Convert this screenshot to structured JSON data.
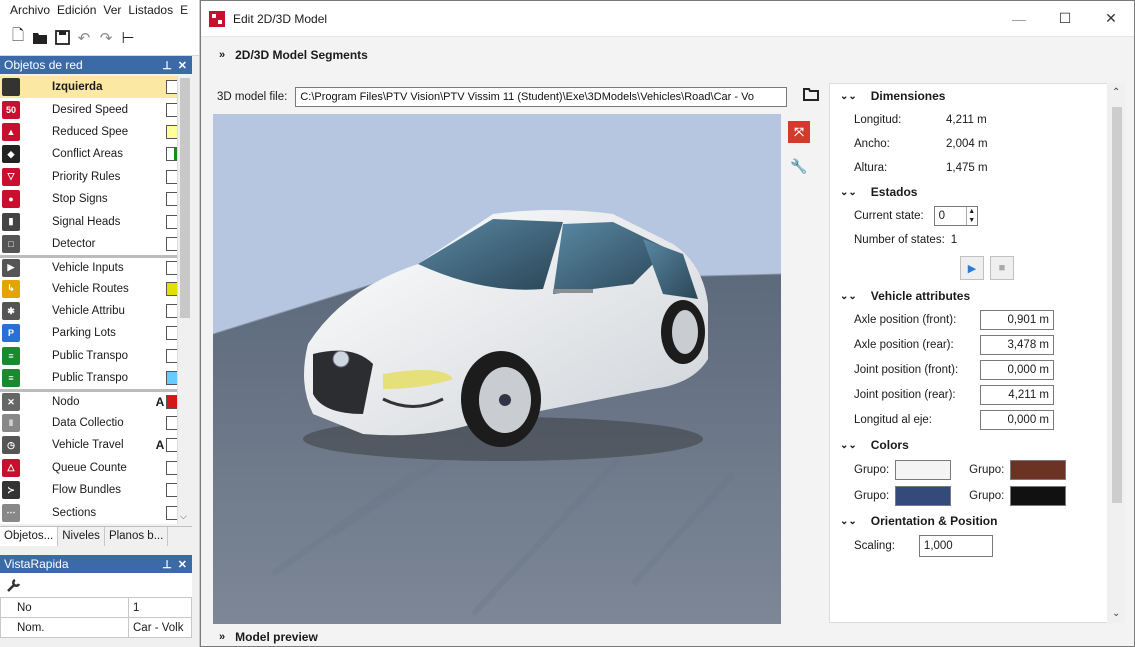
{
  "host": {
    "menu": [
      "Archivo",
      "Edición",
      "Ver",
      "Listados",
      "E"
    ],
    "netobj_title": "Objetos de red",
    "netobj_items": [
      {
        "label": "Izquierda",
        "selected": true,
        "a": ""
      },
      {
        "label": "Desired Speed",
        "a": ""
      },
      {
        "label": "Reduced Spee",
        "a": ""
      },
      {
        "label": "Conflict Areas",
        "a": ""
      },
      {
        "label": "Priority Rules",
        "a": ""
      },
      {
        "label": "Stop Signs",
        "a": ""
      },
      {
        "label": "Signal Heads",
        "a": ""
      },
      {
        "label": "Detector",
        "a": ""
      },
      {
        "label": "Vehicle Inputs",
        "a": ""
      },
      {
        "label": "Vehicle Routes",
        "a": ""
      },
      {
        "label": "Vehicle Attribu",
        "a": ""
      },
      {
        "label": "Parking Lots",
        "a": ""
      },
      {
        "label": "Public Transpo",
        "a": ""
      },
      {
        "label": "Public Transpo",
        "a": ""
      },
      {
        "label": "Nodo",
        "a": "A"
      },
      {
        "label": "Data Collectio",
        "a": ""
      },
      {
        "label": "Vehicle Travel",
        "a": "A"
      },
      {
        "label": "Queue Counte",
        "a": ""
      },
      {
        "label": "Flow Bundles",
        "a": ""
      },
      {
        "label": "Sections",
        "a": ""
      }
    ],
    "tabs": [
      "Objetos...",
      "Niveles",
      "Planos b..."
    ],
    "quick_title": "VistaRapida",
    "quick_rows": [
      {
        "key": "No",
        "value": "1"
      },
      {
        "key": "Nom.",
        "value": "Car - Volk"
      }
    ]
  },
  "dialog": {
    "title": "Edit 2D/3D Model",
    "segments_header": "2D/3D Model Segments",
    "preview_header": "Model preview",
    "file_label": "3D model file:",
    "file_value": "C:\\Program Files\\PTV Vision\\PTV Vissim 11 (Student)\\Exe\\3DModels\\Vehicles\\Road\\Car - Vo"
  },
  "props": {
    "dimensions": {
      "header": "Dimensiones",
      "rows": [
        {
          "key": "Longitud:",
          "value": "4,211 m"
        },
        {
          "key": "Ancho:",
          "value": "2,004 m"
        },
        {
          "key": "Altura:",
          "value": "1,475 m"
        }
      ]
    },
    "states": {
      "header": "Estados",
      "current_label": "Current state:",
      "current_value": "0",
      "count_label": "Number of states:",
      "count_value": "1"
    },
    "attributes": {
      "header": "Vehicle attributes",
      "rows": [
        {
          "key": "Axle position (front):",
          "value": "0,901 m"
        },
        {
          "key": "Axle position (rear):",
          "value": "3,478 m"
        },
        {
          "key": "Joint position (front):",
          "value": "0,000 m"
        },
        {
          "key": "Joint position (rear):",
          "value": "4,211 m"
        },
        {
          "key": "Longitud al eje:",
          "value": "0,000 m"
        }
      ]
    },
    "colors": {
      "header": "Colors",
      "label": "Grupo:",
      "swatches": [
        "#f4f4f4",
        "#6b3324",
        "#334a7a",
        "#111111"
      ]
    },
    "orientation": {
      "header": "Orientation & Position",
      "scaling_label": "Scaling:",
      "scaling_value": "1,000"
    }
  }
}
